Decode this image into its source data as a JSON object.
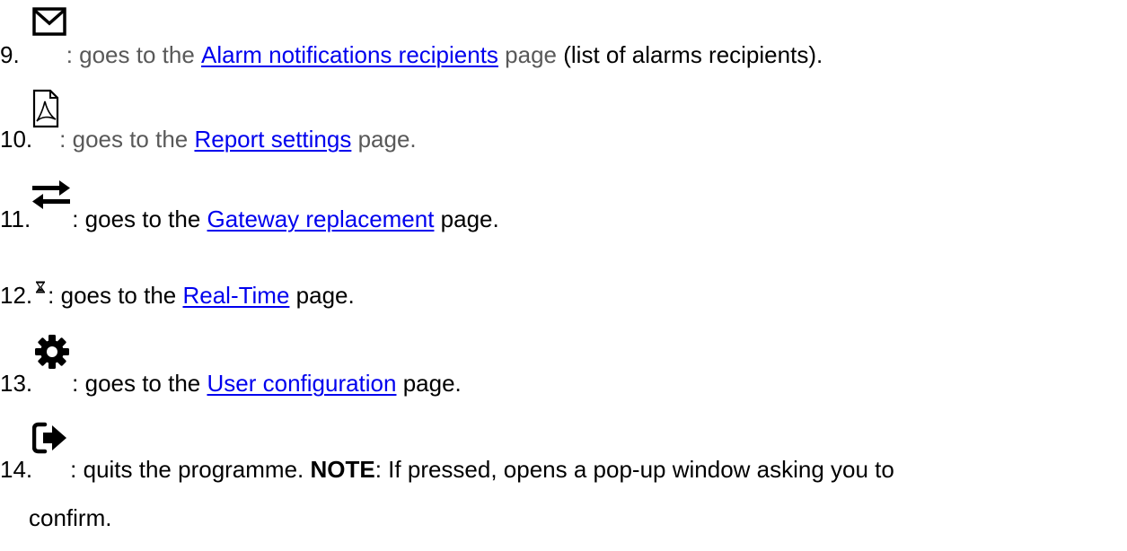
{
  "items": [
    {
      "number": "9.",
      "icon": "envelope-icon",
      "prefix": ": goes to the ",
      "link": "Alarm notifications recipients",
      "suffix": " page",
      "extra": " (list of alarms recipients)."
    },
    {
      "number": "10.",
      "icon": "pdf-file-icon",
      "prefix": ": goes to the ",
      "link": "Report settings",
      "suffix": " page."
    },
    {
      "number": "11.",
      "icon": "exchange-arrows-icon",
      "prefix": ": goes to the ",
      "link": "Gateway replacement",
      "suffix": " page."
    },
    {
      "number": "12.",
      "icon": "hourglass-icon",
      "prefix": ": goes to the ",
      "link": "Real-Time",
      "suffix": " page."
    },
    {
      "number": "13.",
      "icon": "gear-icon",
      "prefix": ": goes to the ",
      "link": "User configuration",
      "suffix": " page."
    },
    {
      "number": "14.",
      "icon": "sign-out-icon",
      "prefix": ": quits the programme. ",
      "note_label": "NOTE",
      "note_text": ": If pressed, opens a pop-up window asking you to",
      "note_continuation": "confirm."
    }
  ],
  "colors": {
    "link": "#0000ee",
    "grey_text": "#595959",
    "text": "#000000"
  }
}
